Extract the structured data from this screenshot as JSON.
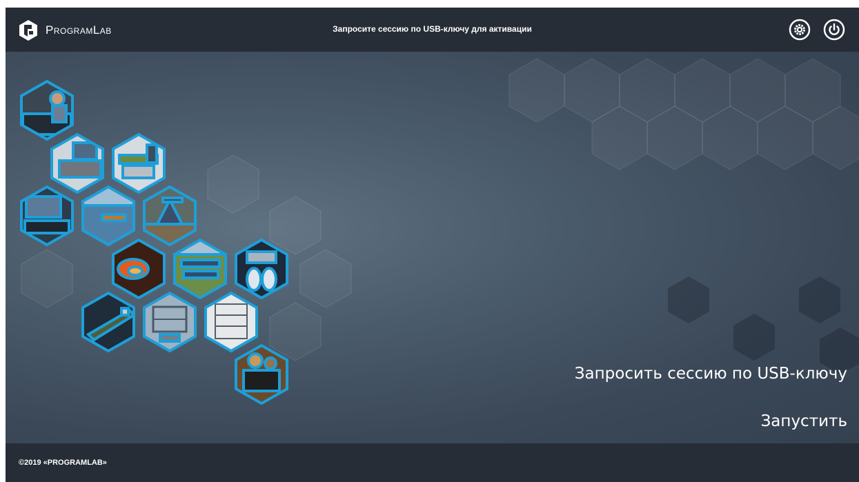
{
  "app": {
    "logo_text": "ProgramLab"
  },
  "header": {
    "title": "Запросите сессию по USB-ключу для активации",
    "settings_icon": "settings-icon",
    "power_icon": "power-icon"
  },
  "main": {
    "request_session_label": "Запросить сессию по USB-ключу",
    "launch_label": "Запустить",
    "hexagon_images": [
      "operator-at-control-panel",
      "lab-bench-monitor",
      "conveyor-machinery",
      "computer-workstation",
      "optics-bench",
      "oil-pump-jack",
      "steel-mill-furnace",
      "electrical-substation",
      "rocket-engines",
      "oil-tanker-ship",
      "industrial-frame",
      "lab-equipment-rack",
      "mechanical-engine"
    ]
  },
  "footer": {
    "copyright": "©2019 «PROGRAMLAB»"
  },
  "colors": {
    "header_bg": "#262d37",
    "hex_border": "#1e9fd8",
    "text": "#ffffff"
  }
}
